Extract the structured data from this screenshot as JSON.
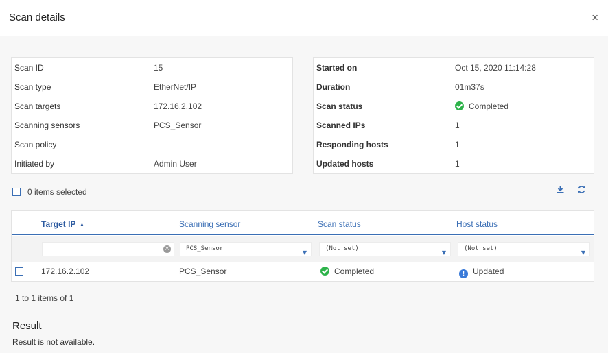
{
  "dialog": {
    "title": "Scan details",
    "close": "×"
  },
  "details_left": [
    {
      "label": "Scan ID",
      "value": "15"
    },
    {
      "label": "Scan type",
      "value": "EtherNet/IP"
    },
    {
      "label": "Scan targets",
      "value": "172.16.2.102"
    },
    {
      "label": "Scanning sensors",
      "value": "PCS_Sensor"
    },
    {
      "label": "Scan policy",
      "value": ""
    },
    {
      "label": "Initiated by",
      "value": "Admin User"
    }
  ],
  "details_right": [
    {
      "label": "Started on",
      "value": "Oct 15, 2020 11:14:28"
    },
    {
      "label": "Duration",
      "value": "01m37s"
    },
    {
      "label": "Scan status",
      "value": "Completed",
      "icon": "check-circle-icon"
    },
    {
      "label": "Scanned IPs",
      "value": "1"
    },
    {
      "label": "Responding hosts",
      "value": "1"
    },
    {
      "label": "Updated hosts",
      "value": "1"
    }
  ],
  "selection": {
    "label": "0 items selected"
  },
  "toolbar": {
    "download_icon": "download-icon",
    "refresh_icon": "refresh-icon"
  },
  "grid": {
    "columns": [
      "Target IP",
      "Scanning sensor",
      "Scan status",
      "Host status"
    ],
    "sorted_column": "Target IP",
    "filters": {
      "target_ip": "",
      "scanning_sensor": "PCS_Sensor",
      "scan_status": "(Not set)",
      "host_status": "(Not set)"
    },
    "rows": [
      {
        "target_ip": "172.16.2.102",
        "scanning_sensor": "PCS_Sensor",
        "scan_status": "Completed",
        "host_status": "Updated"
      }
    ]
  },
  "pager": {
    "text": "1 to 1 items of 1"
  },
  "result": {
    "title": "Result",
    "text": "Result is not available."
  },
  "colors": {
    "accent": "#3b6fb5",
    "success": "#2db34a",
    "info": "#3b7bd9"
  }
}
